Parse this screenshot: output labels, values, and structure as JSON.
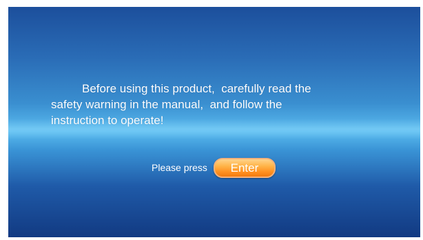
{
  "warning": {
    "line1": "Before using this product,  carefully read the",
    "line2": "safety warning in the manual,  and follow the",
    "line3": "instruction to operate!"
  },
  "prompt": {
    "label": "Please press",
    "button_label": "Enter"
  },
  "colors": {
    "background_top": "#1c4f9c",
    "background_highlight": "#5bbcf0",
    "background_bottom": "#123a82",
    "button": "#ff9a2e",
    "text": "#ffffff"
  }
}
